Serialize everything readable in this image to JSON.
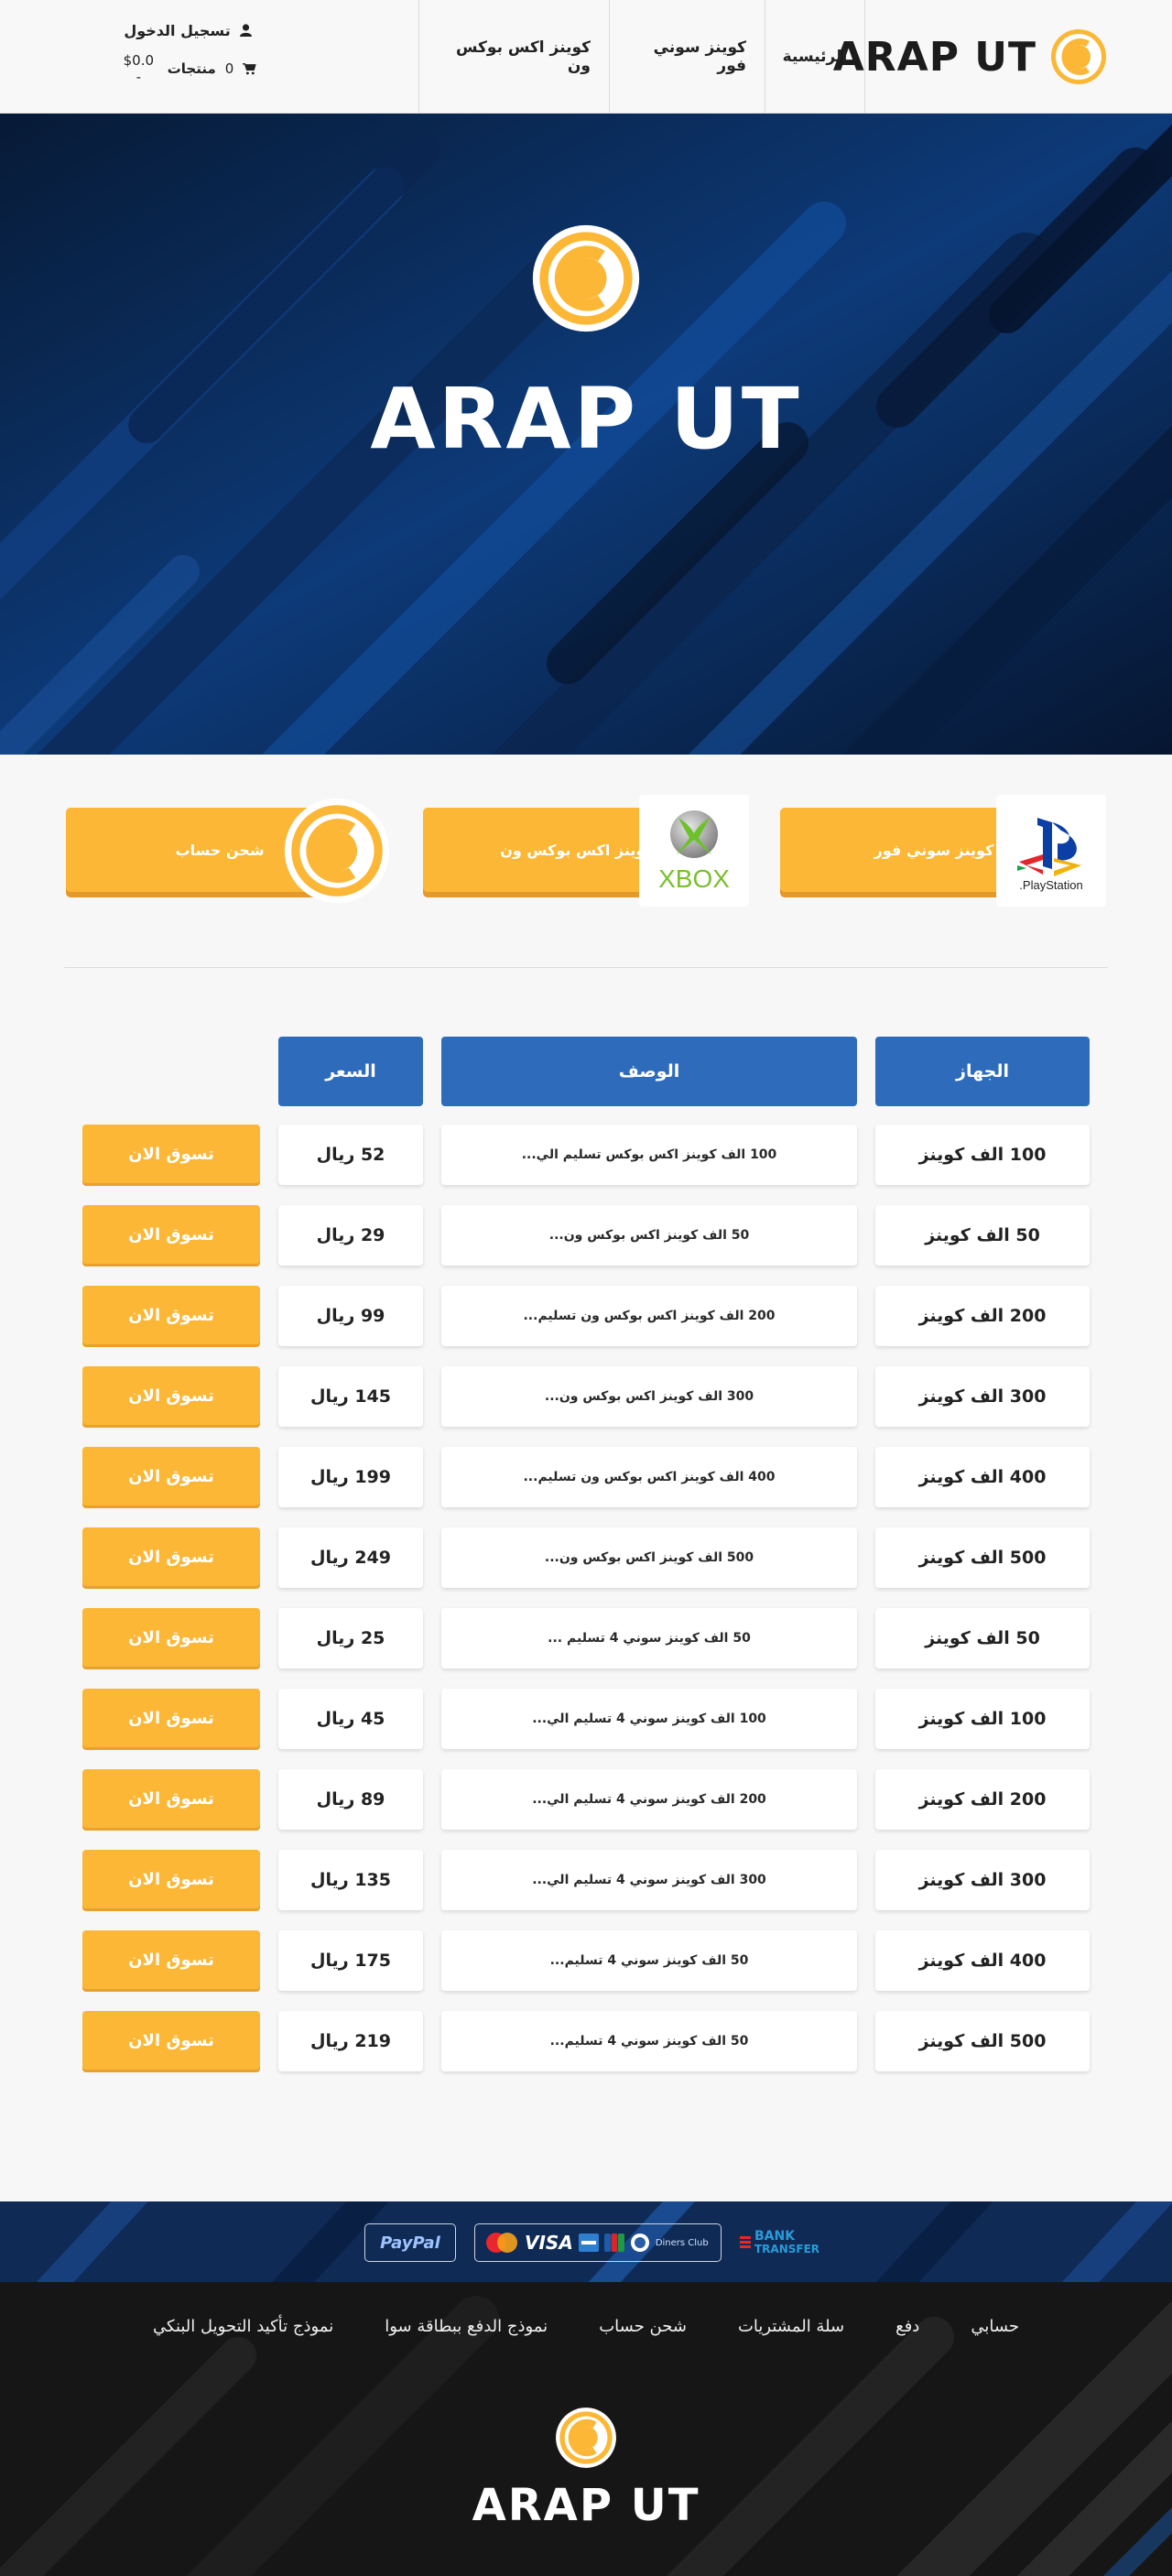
{
  "brand": {
    "name": "ARAP UT"
  },
  "nav": {
    "items": [
      {
        "label": "الرئيسية"
      },
      {
        "label": "كوينز سوني فور"
      },
      {
        "label": "كوينز اكس بوكس ون"
      }
    ]
  },
  "account": {
    "login_label": "تسجيل الدخول",
    "cart_count": "0",
    "cart_label": "منتجات",
    "cart_total": "$0.0 -"
  },
  "hero": {
    "title": "ARAP UT"
  },
  "categories": [
    {
      "label": "كوينز سوني فور",
      "thumb_text": "PlayStation."
    },
    {
      "label": "كوينز اكس بوكس ون",
      "thumb_text": "XBOX"
    },
    {
      "label": "شحن حساب"
    }
  ],
  "table": {
    "headers": {
      "device": "الجهاز",
      "description": "الوصف",
      "price": "السعر"
    },
    "shop_label": "تسوق الان",
    "rows": [
      {
        "device": "100 الف كوينز",
        "description": "100 الف كوينز اكس بوكس تسليم الي...",
        "price": "52 ريال"
      },
      {
        "device": "50 الف كوينز",
        "description": "50 الف كوينز  اكس بوكس ون...",
        "price": "29 ريال"
      },
      {
        "device": "200 الف كوينز",
        "description": "200 الف كوينز  اكس بوكس ون تسليم...",
        "price": "99 ريال"
      },
      {
        "device": "300 الف كوينز",
        "description": "300 الف كوينز  اكس بوكس ون...",
        "price": "145 ريال"
      },
      {
        "device": "400 الف كوينز",
        "description": "400 الف كوينز  اكس بوكس ون تسليم...",
        "price": "199 ريال"
      },
      {
        "device": "500 الف كوينز",
        "description": "500 الف كوينز  اكس بوكس ون...",
        "price": "249 ريال"
      },
      {
        "device": "50 الف كوينز",
        "description": "50 الف كوينز سوني 4 تسليم ...",
        "price": "25 ريال"
      },
      {
        "device": "100 الف كوينز",
        "description": "100 الف كوينز سوني 4 تسليم الي...",
        "price": "45 ريال"
      },
      {
        "device": "200 الف كوينز",
        "description": "200 الف كوينز سوني 4 تسليم الي...",
        "price": "89 ريال"
      },
      {
        "device": "300 الف كوينز",
        "description": "300 الف كوينز سوني 4 تسليم الي...",
        "price": "135 ريال"
      },
      {
        "device": "400 الف كوينز",
        "description": "50 الف كوينز سوني 4 تسليم...",
        "price": "175 ريال"
      },
      {
        "device": "500 الف كوينز",
        "description": "50 الف كوينز سوني 4 تسليم...",
        "price": "219 ريال"
      }
    ]
  },
  "payments": {
    "paypal": "PayPal",
    "cards": [
      "VISA",
      "Diners Club"
    ],
    "bank_line1": "BANK",
    "bank_line2": "TRANSFER"
  },
  "footer": {
    "links": [
      {
        "label": "حسابي"
      },
      {
        "label": "دفع"
      },
      {
        "label": "سلة المشتريات"
      },
      {
        "label": "شحن حساب"
      },
      {
        "label": "نموذج الدفع ببطاقة سوا"
      },
      {
        "label": "نموذج تأكيد التحويل البنكي"
      }
    ],
    "title": "ARAP UT"
  },
  "colors": {
    "accent": "#fbb735",
    "header_blue": "#2e6cbb",
    "hero_navy": "#0a2247"
  },
  "icons": [
    "user-icon",
    "cart-icon",
    "logo-ring-icon",
    "playstation-icon",
    "xbox-icon"
  ]
}
